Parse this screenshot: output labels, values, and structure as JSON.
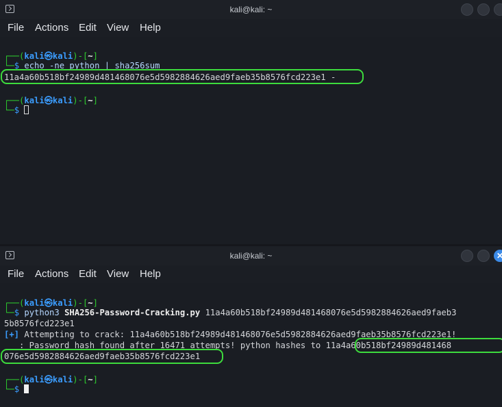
{
  "window1": {
    "title": "kali@kali: ~",
    "menu": [
      "File",
      "Actions",
      "Edit",
      "View",
      "Help"
    ],
    "prompt": {
      "user": "kali",
      "host": "kali",
      "dir": "~"
    },
    "command": "echo -ne python | sha256sum",
    "output_hash": "11a4a60b518bf24989d481468076e5d5982884626aed9faeb35b8576fcd223e1",
    "output_suffix": " -"
  },
  "window2": {
    "title": "kali@kali: ~",
    "menu": [
      "File",
      "Actions",
      "Edit",
      "View",
      "Help"
    ],
    "prompt": {
      "user": "kali",
      "host": "kali",
      "dir": "~"
    },
    "command_prog": "python3",
    "command_script": "SHA256-Password-Cracking.py",
    "command_arg_line1": "11a4a60b518bf24989d481468076e5d5982884626aed9faeb3",
    "command_arg_line2": "5b8576fcd223e1",
    "attempt_tag": "[+]",
    "attempt_text": " Attempting to crack: 11a4a60b518bf24989d481468076e5d5982884626aed9faeb35b8576fcd223e1!",
    "found_text": "   : Password hash found after 16471 attempts! python hashes to ",
    "found_hash_line1": "11a4a60b518bf24989d481468",
    "found_hash_line2": "076e5d5982884626aed9faeb35b8576fcd223e1"
  },
  "colors": {
    "prompt_blue": "#3b9dff",
    "highlight_green": "#3ddc3d",
    "accent_close": "#3c8be8"
  }
}
